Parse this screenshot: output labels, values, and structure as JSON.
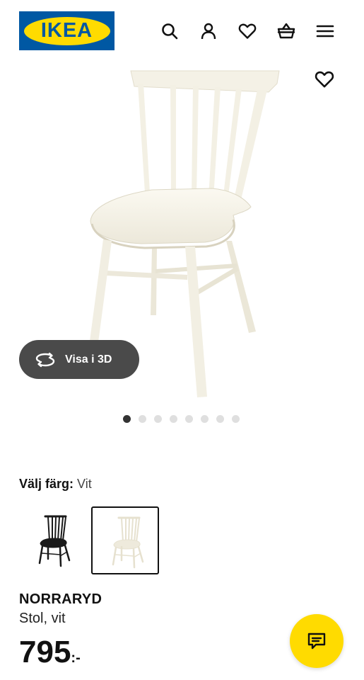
{
  "header": {
    "logo_text": "IKEA",
    "icons": [
      "search-icon",
      "user-icon",
      "heart-icon",
      "basket-icon",
      "menu-icon"
    ]
  },
  "gallery": {
    "view_3d_label": "Visa i 3D",
    "total_images": 8,
    "active_index": 0
  },
  "variants": {
    "label": "Välj färg:",
    "selected_value": "Vit",
    "options": [
      {
        "name": "black",
        "selected": false
      },
      {
        "name": "white",
        "selected": true
      }
    ]
  },
  "product": {
    "name": "NORRARYD",
    "description": "Stol, vit",
    "price": "795",
    "price_suffix": ":-"
  },
  "colors": {
    "brand_blue": "#0058a3",
    "brand_yellow": "#ffdb00",
    "pill_dark": "#4a4a4a"
  }
}
